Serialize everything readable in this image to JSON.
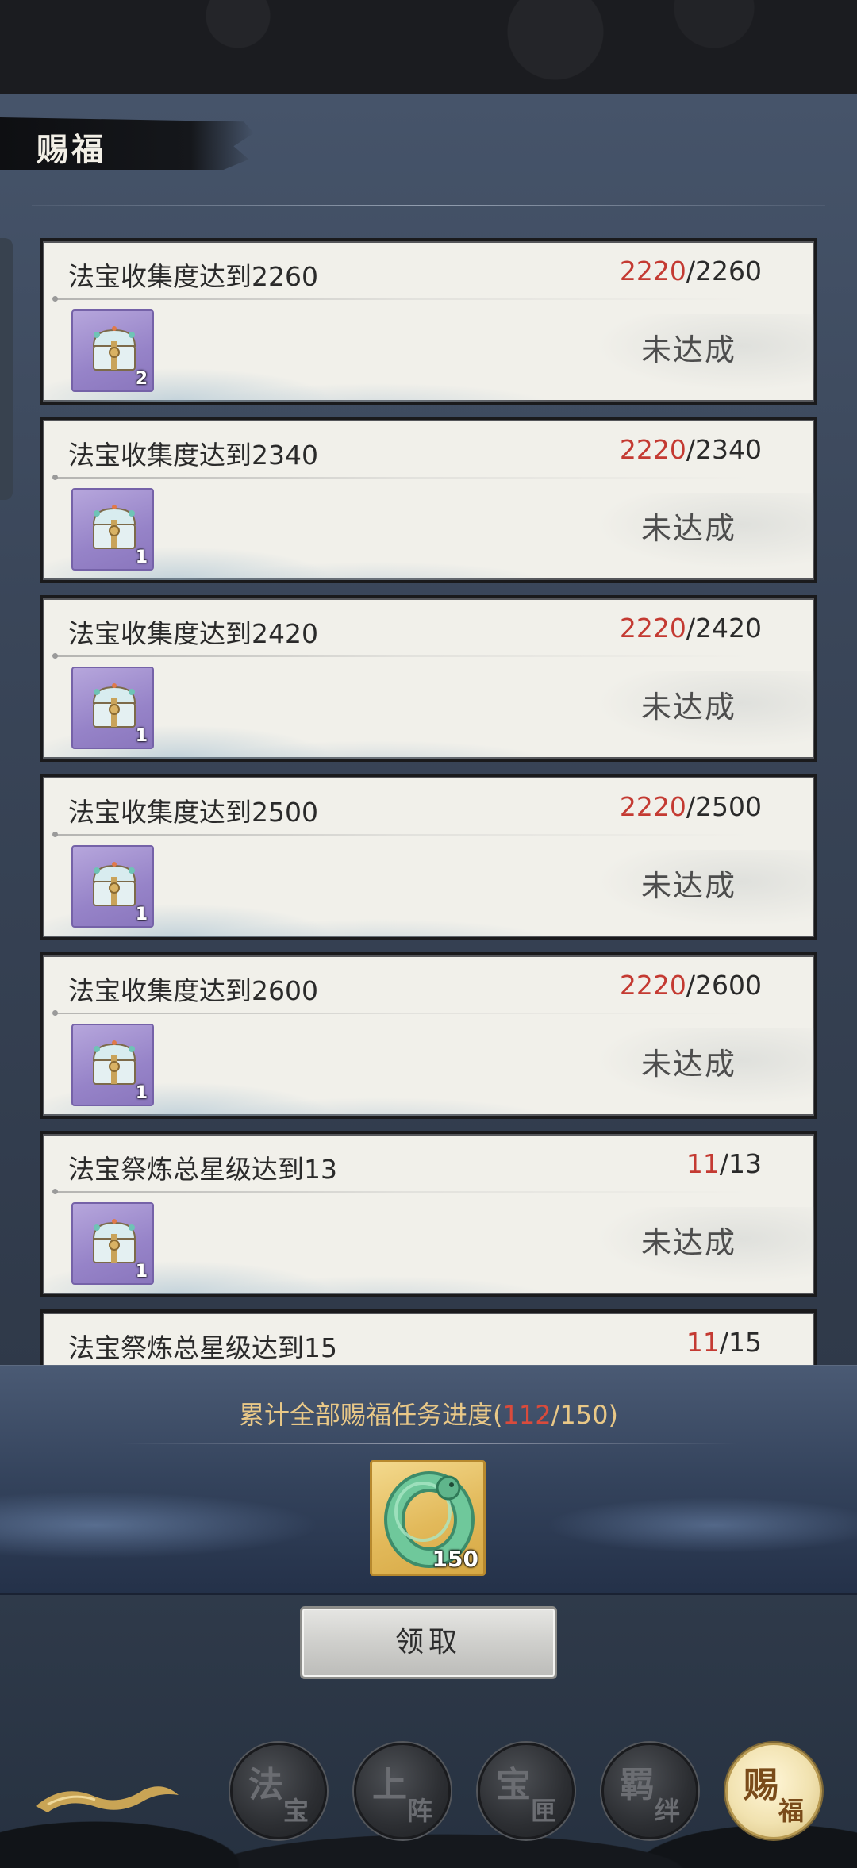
{
  "header": {
    "title": "赐福"
  },
  "tasks": [
    {
      "title": "法宝收集度达到2260",
      "current": "2220",
      "target": "/2260",
      "reward_count": "2",
      "status": "未达成"
    },
    {
      "title": "法宝收集度达到2340",
      "current": "2220",
      "target": "/2340",
      "reward_count": "1",
      "status": "未达成"
    },
    {
      "title": "法宝收集度达到2420",
      "current": "2220",
      "target": "/2420",
      "reward_count": "1",
      "status": "未达成"
    },
    {
      "title": "法宝收集度达到2500",
      "current": "2220",
      "target": "/2500",
      "reward_count": "1",
      "status": "未达成"
    },
    {
      "title": "法宝收集度达到2600",
      "current": "2220",
      "target": "/2600",
      "reward_count": "1",
      "status": "未达成"
    },
    {
      "title": "法宝祭炼总星级达到13",
      "current": "11",
      "target": "/13",
      "reward_count": "1",
      "status": "未达成"
    },
    {
      "title": "法宝祭炼总星级达到15",
      "current": "11",
      "target": "/15",
      "reward_count": "",
      "status": ""
    }
  ],
  "cumulative": {
    "label_prefix": "累计全部赐福任务进度(",
    "current": "112",
    "target": "/150)",
    "reward_icon": "jade-ring-icon",
    "reward_count": "150"
  },
  "claim_button": {
    "label": "领取"
  },
  "bottom_nav": [
    {
      "char1": "法",
      "char2": "宝",
      "active": false
    },
    {
      "char1": "上",
      "char2": "阵",
      "active": false
    },
    {
      "char1": "宝",
      "char2": "匣",
      "active": false
    },
    {
      "char1": "羁",
      "char2": "绊",
      "active": false
    },
    {
      "char1": "赐",
      "char2": "福",
      "active": true
    }
  ],
  "colors": {
    "progress_current": "#c43a32",
    "cumulative_text": "#e9c887",
    "reward_purple": "#9683c8",
    "reward_gold": "#e2b95a"
  }
}
